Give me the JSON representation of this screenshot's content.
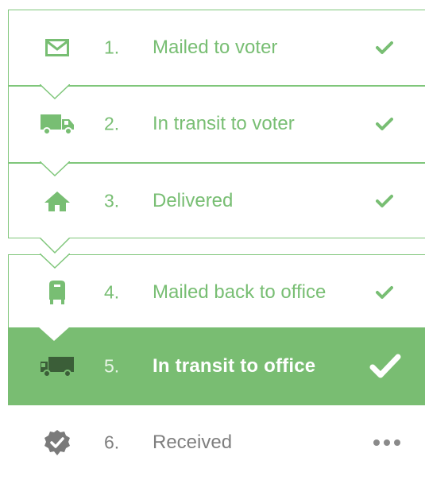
{
  "colors": {
    "accent": "#78be73",
    "active_bg": "#79bd72",
    "muted": "#7f7f7f"
  },
  "steps": [
    {
      "number": "1.",
      "label": "Mailed to voter",
      "icon": "envelope-icon",
      "status": "check-icon"
    },
    {
      "number": "2.",
      "label": "In transit to voter",
      "icon": "truck-icon",
      "status": "check-icon"
    },
    {
      "number": "3.",
      "label": "Delivered",
      "icon": "house-icon",
      "status": "check-icon"
    },
    {
      "number": "4.",
      "label": "Mailed back to office",
      "icon": "mailbox-icon",
      "status": "check-icon"
    },
    {
      "number": "5.",
      "label": "In transit to office",
      "icon": "truck-icon",
      "status": "check-icon"
    },
    {
      "number": "6.",
      "label": "Received",
      "icon": "verified-badge-icon",
      "status": "ellipsis-icon"
    }
  ]
}
